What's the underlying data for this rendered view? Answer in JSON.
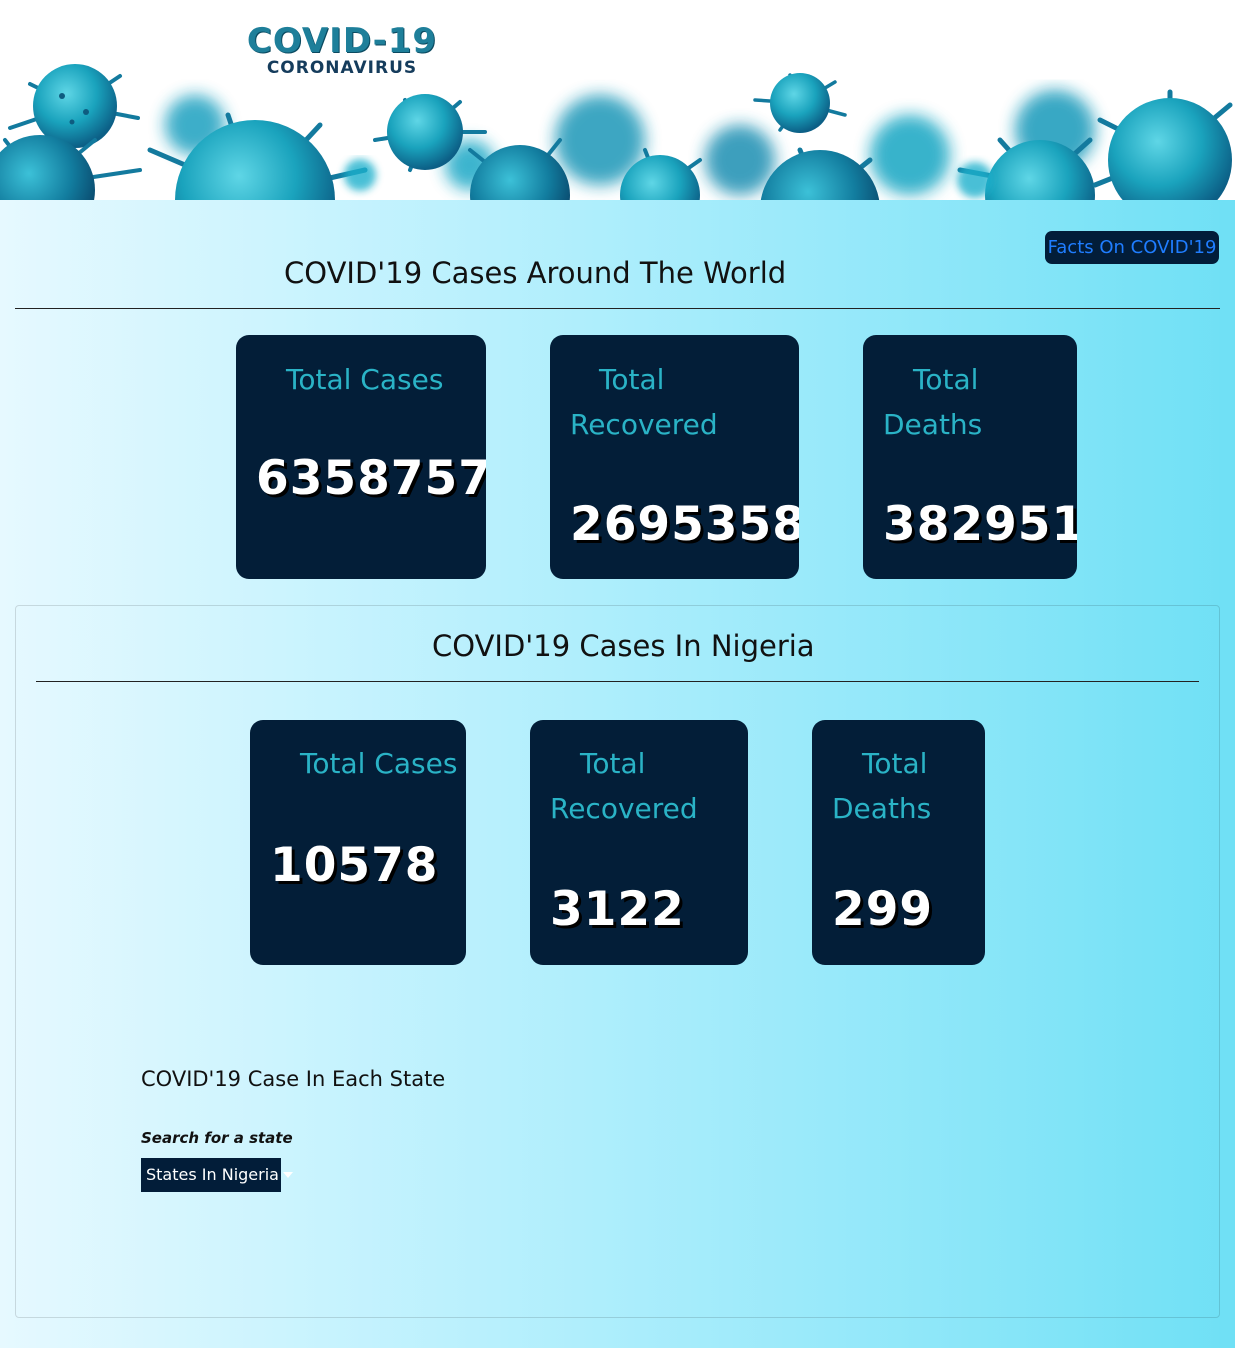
{
  "header": {
    "logo_title": "COVID-19",
    "logo_subtitle": "CORONAVIRUS",
    "facts_button_label": "Facts On COVID'19"
  },
  "world": {
    "heading": "COVID'19 Cases Around The World",
    "total_cases": {
      "label": "Total Cases",
      "value": "6358757"
    },
    "total_recovered": {
      "label_line1": "Total",
      "label_line2": "Recovered",
      "value": "2695358"
    },
    "total_deaths": {
      "label_line1": "Total",
      "label_line2": "Deaths",
      "value": "382951"
    }
  },
  "nigeria": {
    "heading": "COVID'19 Cases In Nigeria",
    "total_cases": {
      "label": "Total Cases",
      "value": "10578"
    },
    "total_recovered": {
      "label_line1": "Total",
      "label_line2": "Recovered",
      "value": "3122"
    },
    "total_deaths": {
      "label_line1": "Total",
      "label_line2": "Deaths",
      "value": "299"
    }
  },
  "states": {
    "heading": "COVID'19 Case In Each State",
    "search_label": "Search for a state",
    "dropdown_label": "States In Nigeria"
  },
  "colors": {
    "card_bg": "#031e38",
    "card_label": "#2ab3c6",
    "facts_button_text": "#1f7dff",
    "virus_teal": "#1aa9c0"
  }
}
